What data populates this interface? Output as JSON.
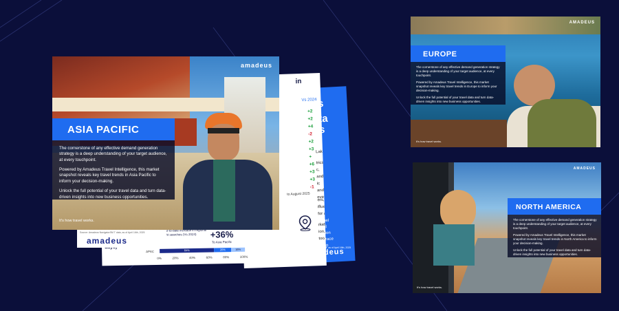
{
  "brand": {
    "logo": "amadeus",
    "logo_caps": "AMADEUS",
    "tagline": "It's how travel works.",
    "accent": "#1f6cf0",
    "background": "#0b0f3a"
  },
  "asia": {
    "title": "ASIA PACIFIC",
    "p1": "The cornerstone of any effective demand generation strategy is a deep understanding of your target audience, at every touchpoint.",
    "p2": "Powered by Amadeus Travel Intelligence, this market snapshot reveals key travel trends in Asia Pacific to inform your decision-making.",
    "p3": "Unlock the full potential of your travel data and turn data-driven insights into new business opportunities.",
    "source": "Source: Amadeus NavigatorSM T data, as of April 16th, 2025"
  },
  "back1": {
    "header_fragment": "in",
    "vs_label": "Vs 2024",
    "deltas": [
      "+2",
      "+2",
      "+4",
      "-2",
      "+2",
      "+3",
      "+",
      "+6",
      "+3",
      "+3",
      "-1"
    ],
    "text_fragments": [
      "Lake",
      "trics",
      "c, and",
      "ic and",
      "ever",
      "ers,",
      "ifluence",
      "for a",
      "rketing",
      "ion, too."
    ],
    "date_note": "to August 2025",
    "stat_caption": "year-to-date increase in regional flight searches (Vs 2024)",
    "stat_value": "+36%",
    "stat_sub": "To Asia Pacific",
    "axis_label": "(by number of days)",
    "row_label": "APAC",
    "bar_values": [
      "64%",
      "20%",
      "16%"
    ],
    "x_ticks": [
      "0%",
      "20%",
      "40%",
      "60%",
      "80%",
      "100%"
    ]
  },
  "back2": {
    "fragments": [
      "tions",
      "r data",
      "ights",
      "annel",
      "ised",
      "nation",
      "mbrace",
      "r top"
    ],
    "source": "Source: Amadeus NaviWide data, as of April 16th, 2025"
  },
  "europe": {
    "title": "EUROPE",
    "p1": "The cornerstone of any effective demand generation strategy is a deep understanding of your target audience, at every touchpoint.",
    "p2": "Powered by Amadeus Travel Intelligence, this market snapshot reveals key travel trends in Europe to inform your decision-making.",
    "p3": "Unlock the full potential of your travel data and turn data-driven insights into new business opportunities."
  },
  "north_america": {
    "title": "NORTH AMERICA",
    "p1": "The cornerstone of any effective demand generation strategy is a deep understanding of your target audience, at every touchpoint.",
    "p2": "Powered by Amadeus Travel Intelligence, this market snapshot reveals key travel trends in North America to inform your decision-making.",
    "p3": "Unlock the full potential of your travel data and turn data-driven insights into new business opportunities."
  }
}
